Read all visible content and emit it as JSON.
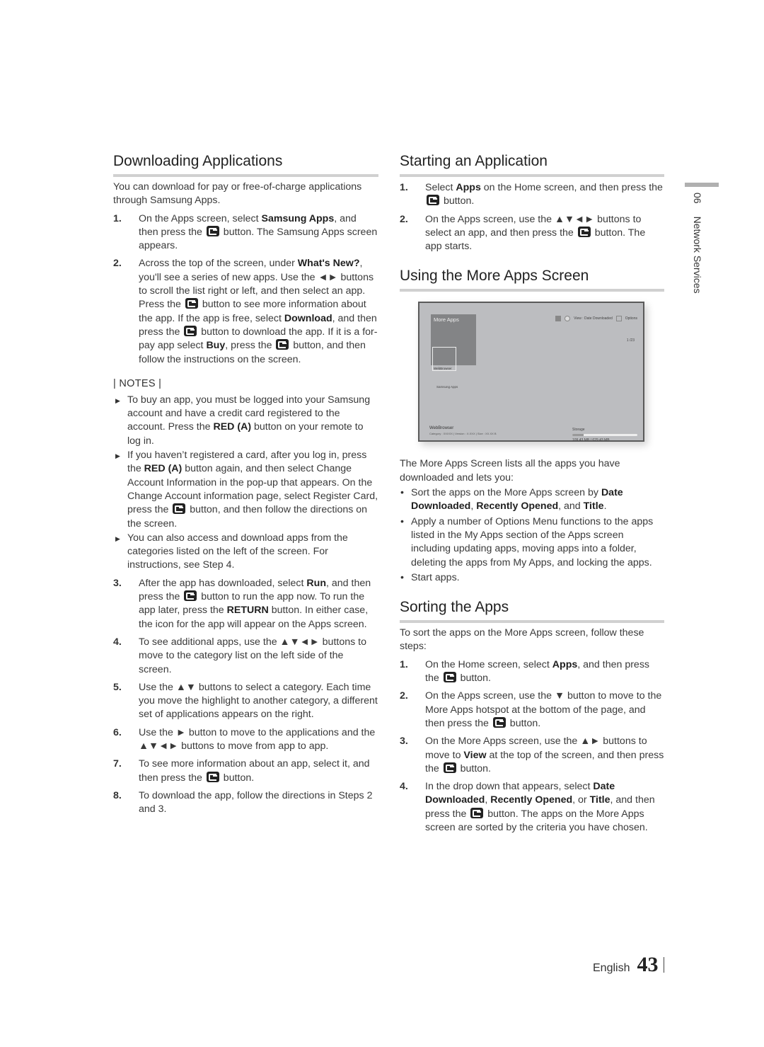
{
  "left": {
    "heading": "Downloading Applications",
    "intro": "You can download for pay or free-of-charge applications through Samsung Apps.",
    "steps_a": [
      {
        "num": "1.",
        "parts": [
          "On the Apps screen, select ",
          "Samsung Apps",
          ", and then press the ",
          "ENTER",
          " button. The Samsung Apps screen appears."
        ]
      },
      {
        "num": "2.",
        "parts": [
          "Across the top of the screen, under ",
          "What's New?",
          ", you'll see a series of new apps. Use the ◄► buttons to scroll the list right or left, and then select an app. Press the ",
          "ENTER",
          " button to see more information about the app. If the app is free, select ",
          "Download",
          ", and then press the ",
          "ENTER",
          " button to download the app. If it is a for-pay app select ",
          "Buy",
          ", press the ",
          "ENTER",
          " button, and then follow the instructions on the screen."
        ]
      }
    ],
    "notes_title": "| NOTES |",
    "notes": [
      {
        "parts": [
          "To buy an app, you must be logged into your Samsung account and have a credit card registered to the account. Press the ",
          "RED (A)",
          " button on your remote to log in."
        ]
      },
      {
        "parts": [
          "If you haven’t registered a card, after you log in, press the ",
          "RED (A)",
          " button again, and then select Change Account Information in the pop-up that appears. On the Change Account information page, select Register Card, press the ",
          "ENTER",
          " button, and then follow the directions on the screen."
        ]
      },
      {
        "parts": [
          "You can also access and download apps from the categories listed on the left of the screen. For instructions, see Step 4."
        ]
      }
    ],
    "steps_b": [
      {
        "num": "3.",
        "parts": [
          "After the app has downloaded, select ",
          "Run",
          ", and then press the ",
          "ENTER",
          " button to run the app now. To run the app later, press the ",
          "RETURN",
          " button. In either case, the icon for the app will appear on the Apps screen."
        ]
      },
      {
        "num": "4.",
        "parts": [
          "To see additional apps, use the ▲▼◄► buttons to move to the category list on the left side of the screen."
        ]
      },
      {
        "num": "5.",
        "parts": [
          "Use the ▲▼ buttons to select a category. Each time you move the highlight to another category, a different set of applications appears on the right."
        ]
      },
      {
        "num": "6.",
        "parts": [
          "Use the ► button to move to the applications and the ▲▼◄► buttons to move from app to app."
        ]
      },
      {
        "num": "7.",
        "parts": [
          "To see more information about an app, select it, and then press the ",
          "ENTER",
          " button."
        ]
      },
      {
        "num": "8.",
        "parts": [
          "To download the app, follow the directions in Steps 2 and 3."
        ]
      }
    ]
  },
  "right": {
    "start": {
      "heading": "Starting an Application",
      "steps": [
        {
          "num": "1.",
          "parts": [
            "Select ",
            "Apps",
            " on the Home screen, and then press the ",
            "ENTER",
            " button."
          ]
        },
        {
          "num": "2.",
          "parts": [
            "On the Apps screen, use the ▲▼◄► buttons to select an app, and then press the ",
            "ENTER",
            " button. The app starts."
          ]
        }
      ]
    },
    "more_apps": {
      "heading": "Using the More Apps Screen",
      "screen": {
        "tile_label": "More Apps",
        "selected_app_tile": "WebBrowser",
        "view_label": "View : Date Downloaded",
        "options_label": "Options",
        "page_counter": "1 /23",
        "category_label": "Samsung Apps",
        "app_name": "WebBrowser",
        "app_meta": "Category : XXXXX  |  Version : X.XXX  |  Size : XX.XX B",
        "storage_label": "Storage",
        "storage_text": "109.43 MB / 629.43 MB",
        "storage_used_fraction": 0.174
      },
      "intro": "The More Apps Screen lists all the apps you have downloaded and lets you:",
      "bullets": [
        {
          "parts": [
            "Sort the apps on the More Apps screen by ",
            "Date Downloaded",
            ", ",
            "Recently Opened",
            ", and ",
            "Title",
            "."
          ]
        },
        {
          "parts": [
            "Apply a number of Options Menu functions to the apps listed in the My Apps section of the Apps screen including updating apps, moving apps into a folder, deleting the apps from My Apps, and locking the apps."
          ]
        },
        {
          "parts": [
            "Start apps."
          ]
        }
      ]
    },
    "sorting": {
      "heading": "Sorting the Apps",
      "intro": "To sort the apps on the More Apps screen, follow these steps:",
      "steps": [
        {
          "num": "1.",
          "parts": [
            "On the Home screen, select ",
            "Apps",
            ", and then press the ",
            "ENTER",
            " button."
          ]
        },
        {
          "num": "2.",
          "parts": [
            "On the Apps screen, use the ▼ button to move to the More Apps hotspot at the bottom of the page, and then press the ",
            "ENTER",
            " button."
          ]
        },
        {
          "num": "3.",
          "parts": [
            "On the More Apps screen, use the ▲► buttons to move to ",
            "View",
            " at the top of the screen, and then press the ",
            "ENTER",
            " button."
          ]
        },
        {
          "num": "4.",
          "parts": [
            "In the drop down that appears, select ",
            "Date Downloaded",
            ", ",
            "Recently Opened",
            ", or ",
            "Title",
            ", and then press the ",
            "ENTER",
            " button. The apps on the More Apps screen are sorted by the criteria you have chosen."
          ]
        }
      ]
    }
  },
  "side_tab": {
    "chapter": "06",
    "title": "Network Services"
  },
  "footer": {
    "language": "English",
    "page_number": "43"
  }
}
